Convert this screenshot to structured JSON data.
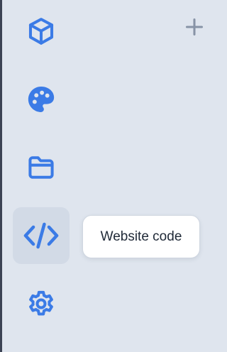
{
  "colors": {
    "background": "#dfe5ee",
    "icon_accent": "#3b7be6",
    "active_item_bg": "#d2dae6",
    "add_icon": "#8793a6",
    "tooltip_bg": "#ffffff",
    "tooltip_text": "#1f2937"
  },
  "sidebar": {
    "items": [
      {
        "id": "packages",
        "icon": "cube-icon",
        "active": false
      },
      {
        "id": "theme",
        "icon": "palette-icon",
        "active": false
      },
      {
        "id": "files",
        "icon": "folder-icon",
        "active": false
      },
      {
        "id": "code",
        "icon": "code-icon",
        "active": true
      },
      {
        "id": "settings",
        "icon": "gear-icon",
        "active": false
      }
    ]
  },
  "add_button": {
    "icon": "plus-icon"
  },
  "tooltip": {
    "text": "Website code"
  }
}
